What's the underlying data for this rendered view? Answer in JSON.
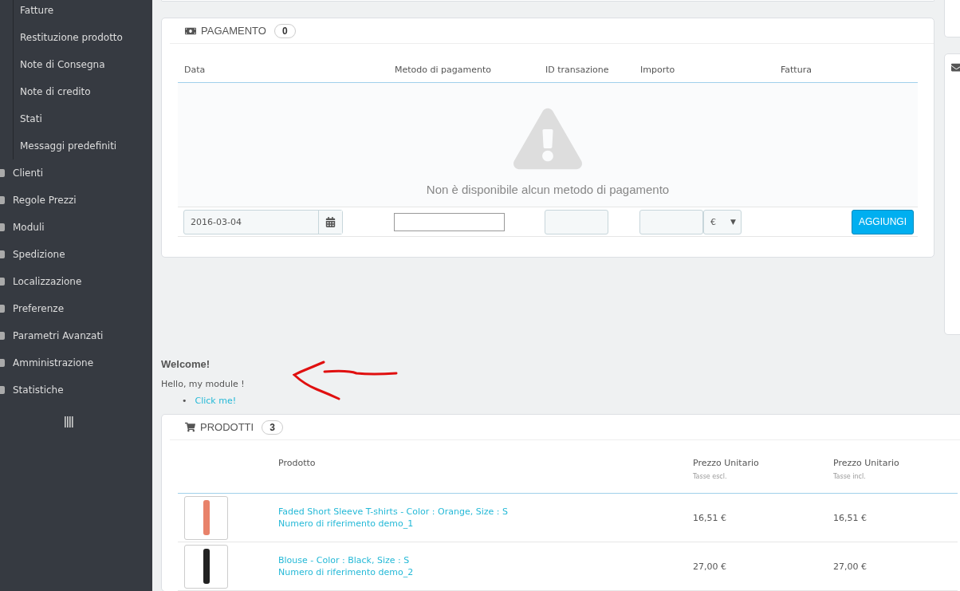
{
  "sidebar": {
    "submenu": [
      {
        "label": "Fatture"
      },
      {
        "label": "Restituzione prodotto"
      },
      {
        "label": "Note di Consegna"
      },
      {
        "label": "Note di credito"
      },
      {
        "label": "Stati"
      },
      {
        "label": "Messaggi predefiniti"
      }
    ],
    "items": [
      {
        "label": "Clienti"
      },
      {
        "label": "Regole Prezzi"
      },
      {
        "label": "Moduli"
      },
      {
        "label": "Spedizione"
      },
      {
        "label": "Localizzazione"
      },
      {
        "label": "Preferenze"
      },
      {
        "label": "Parametri Avanzati"
      },
      {
        "label": "Amministrazione"
      },
      {
        "label": "Statistiche"
      }
    ]
  },
  "payment": {
    "title": "PAGAMENTO",
    "count": "0",
    "columns": [
      "Data",
      "Metodo di pagamento",
      "ID transazione",
      "Importo",
      "Fattura"
    ],
    "empty_message": "Non è disponibile alcun metodo di pagamento",
    "date_value": "2016-03-04",
    "currency": "€",
    "currency_caret": "▼",
    "add_button": "AGGIUNGI"
  },
  "module": {
    "title": "Welcome!",
    "text": "Hello, my module !",
    "bullet": "•",
    "link": "Click me!"
  },
  "products": {
    "title": "PRODOTTI",
    "count": "3",
    "columns": [
      {
        "label": "Prodotto"
      },
      {
        "label": "Prezzo Unitario",
        "sub": "Tasse escl."
      },
      {
        "label": "Prezzo Unitario",
        "sub": "Tasse incl."
      }
    ],
    "rows": [
      {
        "name": "Faded Short Sleeve T-shirts - Color : Orange, Size : S",
        "reference": "Numero di riferimento demo_1",
        "price_excl": "16,51 €",
        "price_incl": "16,51 €"
      },
      {
        "name": "Blouse - Color : Black, Size : S",
        "reference": "Numero di riferimento demo_2",
        "price_excl": "27,00 €",
        "price_incl": "27,00 €"
      }
    ]
  }
}
